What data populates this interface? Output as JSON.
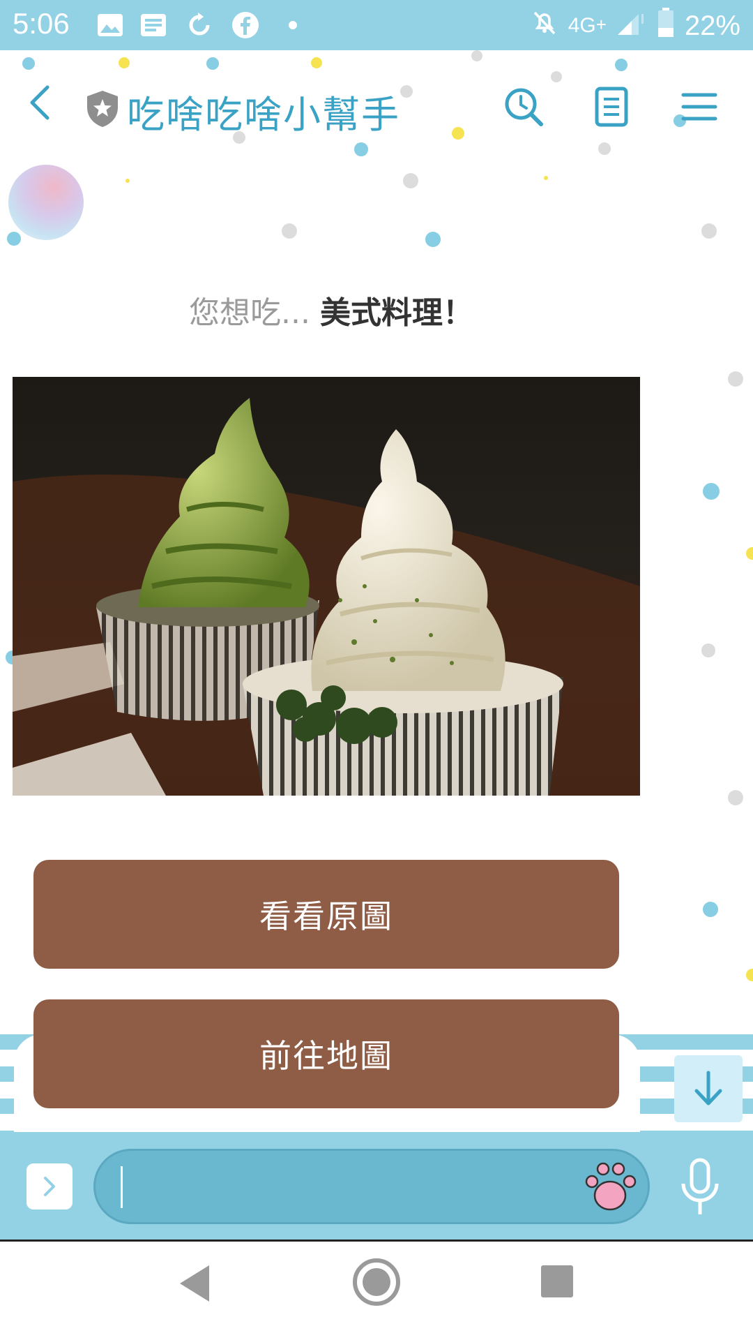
{
  "status_bar": {
    "time": "5:06",
    "network": "4G",
    "battery": "22%",
    "icons": [
      "image-icon",
      "news-icon",
      "sync-icon",
      "facebook-icon",
      "dot-icon",
      "mute-icon",
      "signal-icon",
      "battery-icon"
    ]
  },
  "header": {
    "title": "吃啥吃啥小幫手",
    "accent_color": "#3aa2c4",
    "icons": [
      "back-icon",
      "shield-star-icon",
      "history-search-icon",
      "notes-icon",
      "menu-icon"
    ]
  },
  "message": {
    "prompt_prefix": "您想吃...",
    "prompt_main": "美式料理！",
    "photo_subject": "ice-cream-photo"
  },
  "actions": [
    {
      "label": "看看原圖"
    },
    {
      "label": "前往地圖"
    }
  ],
  "colors": {
    "theme_blue": "#93d1e5",
    "button_brown": "#8f5c45",
    "input_fill": "#6ab8cf"
  }
}
